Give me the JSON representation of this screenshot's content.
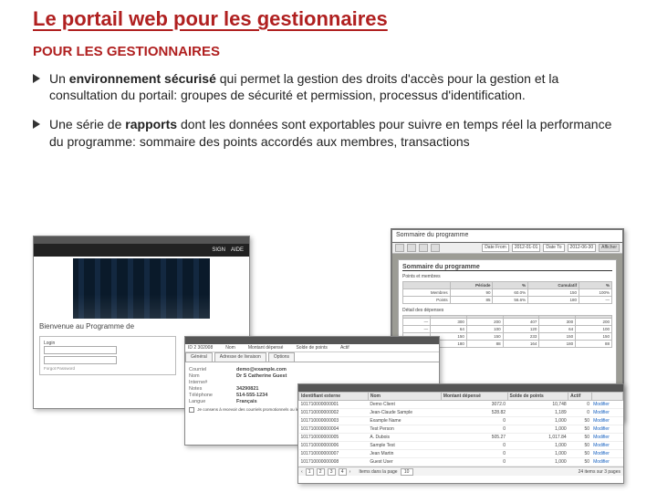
{
  "title": "Le portail web pour les gestionnaires",
  "subtitle": "POUR LES GESTIONNAIRES",
  "bullets": [
    {
      "pre": "Un ",
      "bold": "environnement sécurisé",
      "post": " qui permet la gestion des droits d'accès pour la gestion et la consultation du portail: groupes de sécurité et permission, processus d'identification."
    },
    {
      "pre": "Une série de ",
      "bold": "rapports",
      "post": " dont les données sont exportables pour suivre en temps réel la performance du programme: sommaire des points accordés aux membres, transactions"
    }
  ],
  "mock_login": {
    "nav_items": [
      "SIGN",
      "AIDE"
    ],
    "welcome": "Bienvenue au Programme de",
    "login_label": "Login",
    "forgot": "Forgot Password"
  },
  "mock_report": {
    "window_title": "Sommaire du programme",
    "date_from_label": "Date From",
    "date_from": "2012-01-01",
    "date_to_label": "Date To",
    "date_to": "2012-06-30",
    "submit": "Afficher",
    "paper_title": "Sommaire du programme",
    "section1": "Points et membres",
    "section2": "Détail des dépenses",
    "cols": [
      "",
      "Période",
      "%",
      "Cumulatif",
      "%"
    ],
    "rows1": [
      [
        "Membres",
        "90",
        "60.0%",
        "150",
        "100%"
      ],
      [
        "Points",
        "85",
        "56.6%",
        "180",
        "—"
      ]
    ]
  },
  "mock_form": {
    "header_cols": [
      "ID 2 302008",
      "Nom",
      "Montant dépensé",
      "Solde de points",
      "Actif"
    ],
    "tabs": [
      "Général",
      "Adresse de livraison",
      "Options"
    ],
    "fields": {
      "courriel_k": "Courriel",
      "courriel_v": "demo@example.com",
      "nom_k": "Nom",
      "nom_v": "Dr S Catherine Guest",
      "interne_k": "Interne#",
      "interne_v": "",
      "notes_k": "Notes",
      "notes_v": "34290821",
      "tel_k": "Téléphone",
      "tel_v": "514-555-1234",
      "langue_k": "Langue",
      "langue_v": "Français"
    },
    "checkbox_label": "Je consens à recevoir des courriels promotionnels ou les communications"
  },
  "mock_table": {
    "cols": [
      "Identifiant externe",
      "Nom",
      "Montant dépensé",
      "Solde de points",
      "Actif",
      ""
    ],
    "rows": [
      [
        "101710000000001",
        "Demo Client",
        "3072.0",
        "10,748",
        "0",
        "Modifier"
      ],
      [
        "101710000000002",
        "Jean-Claude Sample",
        "528.82",
        "1,189",
        "0",
        "Modifier"
      ],
      [
        "101710000000003",
        "Example Name",
        "0",
        "1,000",
        "50",
        "Modifier"
      ],
      [
        "101710000000004",
        "Test Person",
        "0",
        "1,000",
        "50",
        "Modifier"
      ],
      [
        "101710000000005",
        "A. Dubois",
        "505.27",
        "1,017.84",
        "50",
        "Modifier"
      ],
      [
        "101710000000006",
        "Sample Test",
        "0",
        "1,000",
        "50",
        "Modifier"
      ],
      [
        "101710000000007",
        "Jean Martin",
        "0",
        "1,000",
        "50",
        "Modifier"
      ],
      [
        "101710000000008",
        "Guest User",
        "0",
        "1,000",
        "50",
        "Modifier"
      ]
    ],
    "pager": {
      "pages": [
        "1",
        "2",
        "3",
        "4"
      ],
      "items_label": "Items dans la page",
      "items_val": "10",
      "footer_right": "24 items sur 3 pages"
    }
  }
}
